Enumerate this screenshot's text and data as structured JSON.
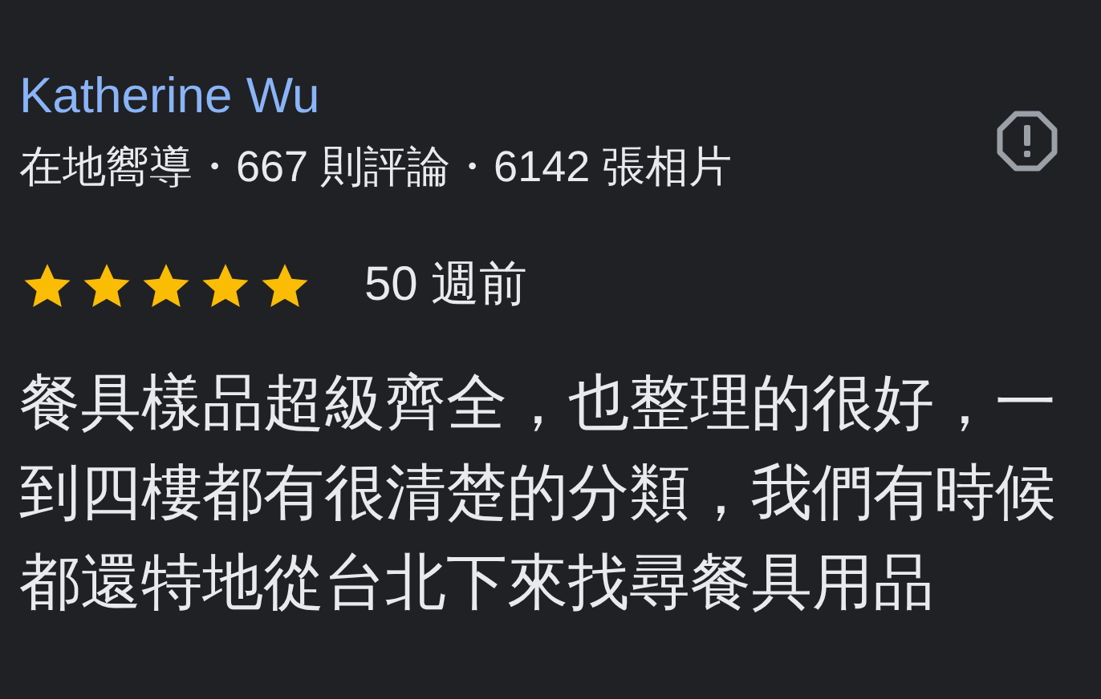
{
  "reviewer": {
    "name": "Katherine Wu",
    "meta": "在地嚮導・667 則評論・6142 張相片"
  },
  "review": {
    "stars": 5,
    "time": "50 週前",
    "text": "餐具樣品超級齊全，也整理的很好，一到四樓都有很清楚的分類，我們有時候都還特地從台北下來找尋餐具用品"
  }
}
